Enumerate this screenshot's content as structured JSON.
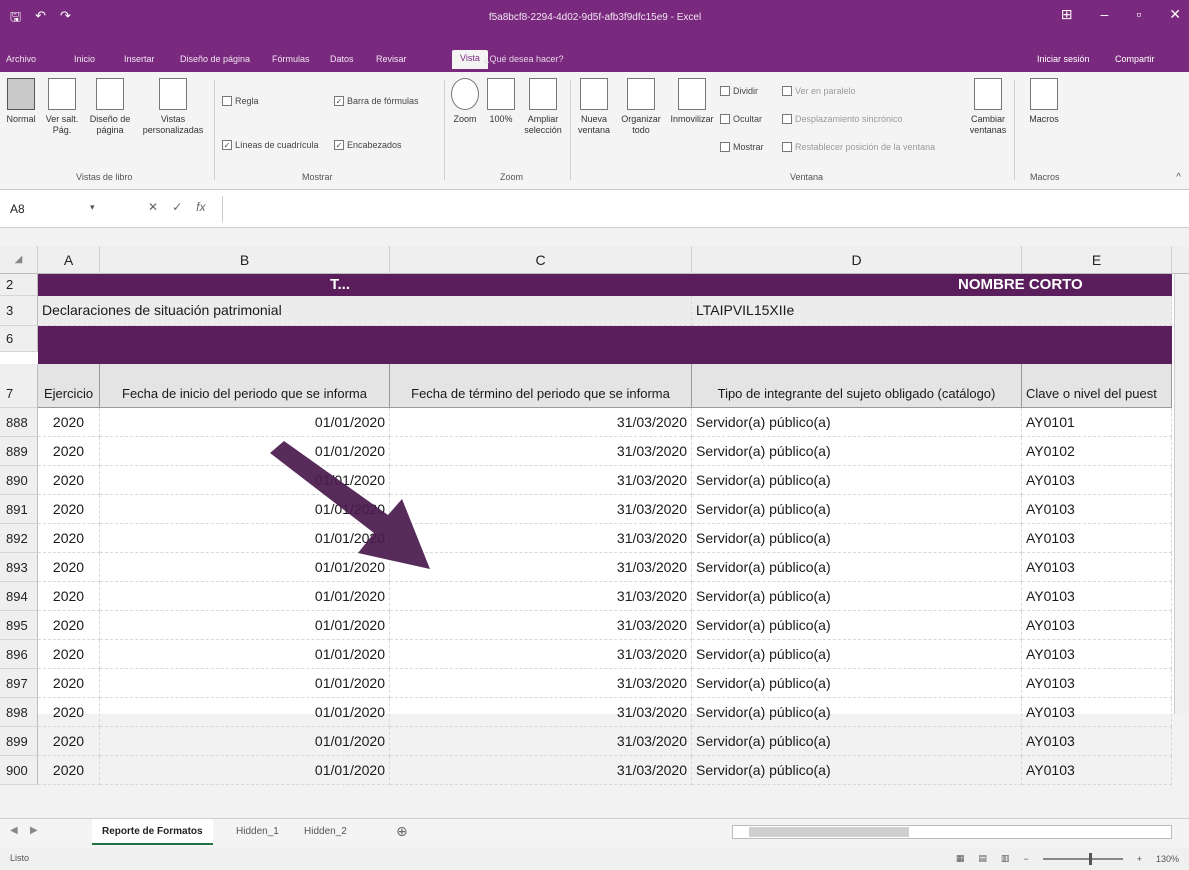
{
  "window": {
    "title": "f5a8bcf8-2294-4d02-9d5f-afb3f9dfc15e9 - Excel",
    "minimize": "–",
    "maximize": "▫",
    "close": "✕"
  },
  "ribbon_tabs": [
    "Archivo",
    "Inicio",
    "Insertar",
    "Diseño de página",
    "Fórmulas",
    "Datos",
    "Revisar",
    "Vista"
  ],
  "active_tab": "Vista",
  "tell_me": "¿Qué desea hacer?",
  "sign_in": "Iniciar sesión",
  "share": "Compartir",
  "ribbon": {
    "views_group": "Vistas de libro",
    "normal": "Normal",
    "page_break": "Ver salt. Pág.",
    "page_layout": "Diseño de página",
    "custom_views": "Vistas personalizadas",
    "show_group": "Mostrar",
    "ruler": "Regla",
    "gridlines": "Líneas de cuadrícula",
    "formula_bar": "Barra de fórmulas",
    "headings": "Encabezados",
    "zoom_group": "Zoom",
    "zoom": "Zoom",
    "zoom100": "100%",
    "zoom_selection": "Ampliar selección",
    "window_group": "Ventana",
    "new_window": "Nueva ventana",
    "arrange_all": "Organizar todo",
    "freeze_panes": "Inmovilizar",
    "split": "Dividir",
    "hide": "Ocultar",
    "unhide": "Mostrar",
    "side_by_side": "Ver en paralelo",
    "sync_scroll": "Desplazamiento sincrónico",
    "reset_position": "Restablecer posición de la ventana",
    "switch_windows": "Cambiar ventanas",
    "macros_group": "Macros",
    "macros": "Macros"
  },
  "formula_bar": {
    "name_box": "A8",
    "fx": "fx",
    "value": ""
  },
  "columns": [
    "A",
    "B",
    "C",
    "D",
    "E"
  ],
  "sheet": {
    "title_row_num": "2",
    "title_partial": "T...",
    "nombre_corto": "NOMBRE CORTO",
    "row3_num": "3",
    "row3_a": "Declaraciones de situación patrimonial",
    "row3_d": "LTAIPVIL15XIIe",
    "row6_num": "6",
    "header_row_num": "7",
    "headers": [
      "Ejercicio",
      "Fecha de inicio del periodo que se informa",
      "Fecha de término del periodo que se informa",
      "Tipo de integrante del sujeto obligado (catálogo)",
      "Clave o nivel del puest"
    ],
    "rows": [
      {
        "n": "888",
        "a": "2020",
        "b": "01/01/2020",
        "c": "31/03/2020",
        "d": "Servidor(a) público(a)",
        "e": "AY0101"
      },
      {
        "n": "889",
        "a": "2020",
        "b": "01/01/2020",
        "c": "31/03/2020",
        "d": "Servidor(a) público(a)",
        "e": "AY0102"
      },
      {
        "n": "890",
        "a": "2020",
        "b": "01/01/2020",
        "c": "31/03/2020",
        "d": "Servidor(a) público(a)",
        "e": "AY0103"
      },
      {
        "n": "891",
        "a": "2020",
        "b": "01/01/2020",
        "c": "31/03/2020",
        "d": "Servidor(a) público(a)",
        "e": "AY0103"
      },
      {
        "n": "892",
        "a": "2020",
        "b": "01/01/2020",
        "c": "31/03/2020",
        "d": "Servidor(a) público(a)",
        "e": "AY0103"
      },
      {
        "n": "893",
        "a": "2020",
        "b": "01/01/2020",
        "c": "31/03/2020",
        "d": "Servidor(a) público(a)",
        "e": "AY0103"
      },
      {
        "n": "894",
        "a": "2020",
        "b": "01/01/2020",
        "c": "31/03/2020",
        "d": "Servidor(a) público(a)",
        "e": "AY0103"
      },
      {
        "n": "895",
        "a": "2020",
        "b": "01/01/2020",
        "c": "31/03/2020",
        "d": "Servidor(a) público(a)",
        "e": "AY0103"
      },
      {
        "n": "896",
        "a": "2020",
        "b": "01/01/2020",
        "c": "31/03/2020",
        "d": "Servidor(a) público(a)",
        "e": "AY0103"
      },
      {
        "n": "897",
        "a": "2020",
        "b": "01/01/2020",
        "c": "31/03/2020",
        "d": "Servidor(a) público(a)",
        "e": "AY0103"
      },
      {
        "n": "898",
        "a": "2020",
        "b": "01/01/2020",
        "c": "31/03/2020",
        "d": "Servidor(a) público(a)",
        "e": "AY0103"
      },
      {
        "n": "899",
        "a": "2020",
        "b": "01/01/2020",
        "c": "31/03/2020",
        "d": "Servidor(a) público(a)",
        "e": "AY0103"
      },
      {
        "n": "900",
        "a": "2020",
        "b": "01/01/2020",
        "c": "31/03/2020",
        "d": "Servidor(a) público(a)",
        "e": "AY0103"
      }
    ]
  },
  "sheet_tabs": [
    "Reporte de Formatos",
    "Hidden_1",
    "Hidden_2"
  ],
  "active_sheet": "Reporte de Formatos",
  "status": {
    "ready": "Listo",
    "zoom_level": "130%"
  },
  "colors": {
    "title_bar": "#7a2a7e",
    "header_band": "#5a1e5c"
  }
}
